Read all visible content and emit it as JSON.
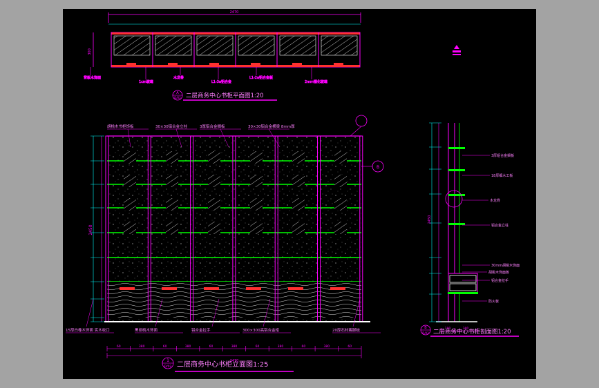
{
  "colors": {
    "background": "#000000",
    "frame": "#a3a3a3",
    "magenta": "#ff00ff",
    "green": "#00ff00",
    "red": "#ff3030",
    "white": "#ffffff",
    "cyan": "#00ffff",
    "yellow": "#ffff00"
  },
  "plan": {
    "title": "二层商务中心书柜平面图1:20",
    "index_number": "A",
    "index_sheet": "D/02",
    "top_dimension": "2470",
    "left_dimension": "300",
    "labels": [
      "背板木饰面",
      "1cm玻璃",
      "木龙骨",
      "L1-3a铝合金",
      "L1-2a铝合金板",
      "2mm钢化玻璃"
    ]
  },
  "elevation": {
    "title": "二层商务中心书柜立面图1:25",
    "index_number": "1",
    "index_sheet": "D/02",
    "top_labels": [
      "胡桃木书柜饰板",
      "30×30铝合金立柱",
      "3厚铝合金搁板",
      "30×30铝合金横梁 8mm厚"
    ],
    "bottom_labels": [
      "15厚白橡木饰面 实木收口",
      "黑胡桃木饰面",
      "铝合金拉手",
      "300×300高铝合金柜",
      "20厚石材踢脚板"
    ],
    "total_width": "2470",
    "module_widths": [
      "60",
      "380",
      "60",
      "380",
      "60",
      "380",
      "60",
      "380",
      "60",
      "380",
      "60"
    ],
    "left_dimension": "2450",
    "callout": "B"
  },
  "section": {
    "title": "二层商务中心书柜剖面图1:20",
    "index_number": "B",
    "index_sheet": "D/02",
    "labels": [
      "3厚铝合金搁板",
      "18厚细木工板",
      "木龙骨",
      "铝合金立柱",
      "30mm胡桃木饰面",
      "胡桃木饰面板",
      "铝合金拉手",
      "防火板"
    ],
    "bottom_dimensions": [
      "100",
      "300"
    ],
    "left_dimension": "2450"
  }
}
